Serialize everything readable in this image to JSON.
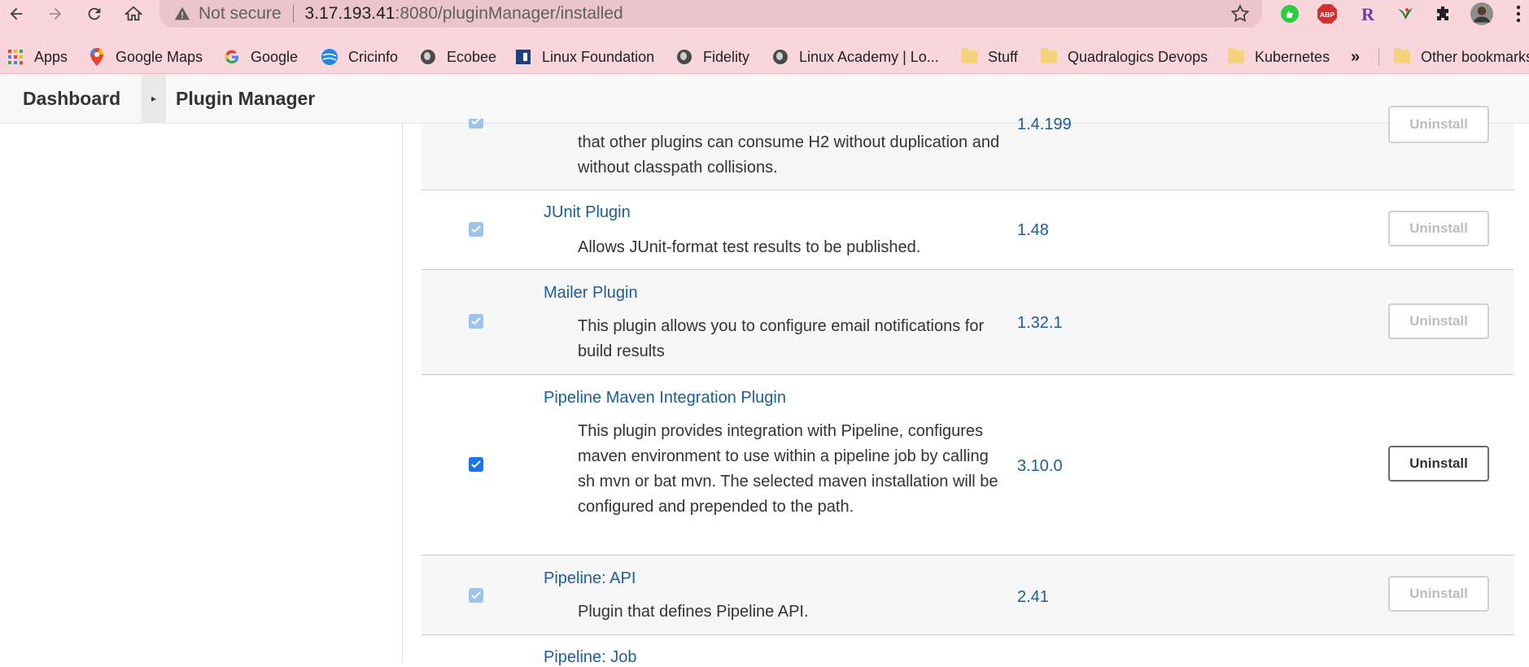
{
  "browser": {
    "security_label": "Not secure",
    "url_host": "3.17.193.41",
    "url_path": ":8080/pluginManager/installed",
    "bookmarks": [
      {
        "label": "Apps",
        "icon": "apps-grid-icon"
      },
      {
        "label": "Google Maps",
        "icon": "google-maps-icon"
      },
      {
        "label": "Google",
        "icon": "google-icon"
      },
      {
        "label": "Cricinfo",
        "icon": "cricinfo-icon"
      },
      {
        "label": "Ecobee",
        "icon": "globe-icon"
      },
      {
        "label": "Linux Foundation",
        "icon": "linux-foundation-icon"
      },
      {
        "label": "Fidelity",
        "icon": "globe-icon"
      },
      {
        "label": "Linux Academy | Lo...",
        "icon": "globe-icon"
      },
      {
        "label": "Stuff",
        "icon": "folder-icon"
      },
      {
        "label": "Quadralogics Devops",
        "icon": "folder-icon"
      },
      {
        "label": "Kubernetes",
        "icon": "folder-icon"
      }
    ],
    "overflow_label": "»",
    "other_bookmarks_label": "Other bookmarks",
    "extensions": [
      "green-extension-icon",
      "adblock-plus-icon",
      "r-extension-icon",
      "bird-extension-icon",
      "puzzle-extensions-icon",
      "profile-avatar-icon"
    ]
  },
  "breadcrumb": {
    "dashboard": "Dashboard",
    "separator": "▸",
    "current": "Plugin Manager"
  },
  "plugins": [
    {
      "name": "",
      "description": "that other plugins can consume H2 without duplication and without classpath collisions.",
      "version": "1.4.199",
      "checked": true,
      "enabled": false,
      "uninstall_label": "Uninstall"
    },
    {
      "name": "JUnit Plugin",
      "description": "Allows JUnit-format test results to be published.",
      "version": "1.48",
      "checked": true,
      "enabled": false,
      "uninstall_label": "Uninstall"
    },
    {
      "name": "Mailer Plugin",
      "description": "This plugin allows you to configure email notifications for build results",
      "version": "1.32.1",
      "checked": true,
      "enabled": false,
      "uninstall_label": "Uninstall"
    },
    {
      "name": "Pipeline Maven Integration Plugin",
      "description": "This plugin provides integration with Pipeline, configures maven environment to use within a pipeline job by calling sh mvn or bat mvn. The selected maven installation will be configured and prepended to the path.",
      "version": "3.10.0",
      "checked": true,
      "enabled": true,
      "uninstall_label": "Uninstall"
    },
    {
      "name": "Pipeline: API",
      "description": "Plugin that defines Pipeline API.",
      "version": "2.41",
      "checked": true,
      "enabled": false,
      "uninstall_label": "Uninstall"
    },
    {
      "name": "Pipeline: Job",
      "description": "",
      "version": "",
      "checked": true,
      "enabled": false,
      "uninstall_label": ""
    }
  ]
}
